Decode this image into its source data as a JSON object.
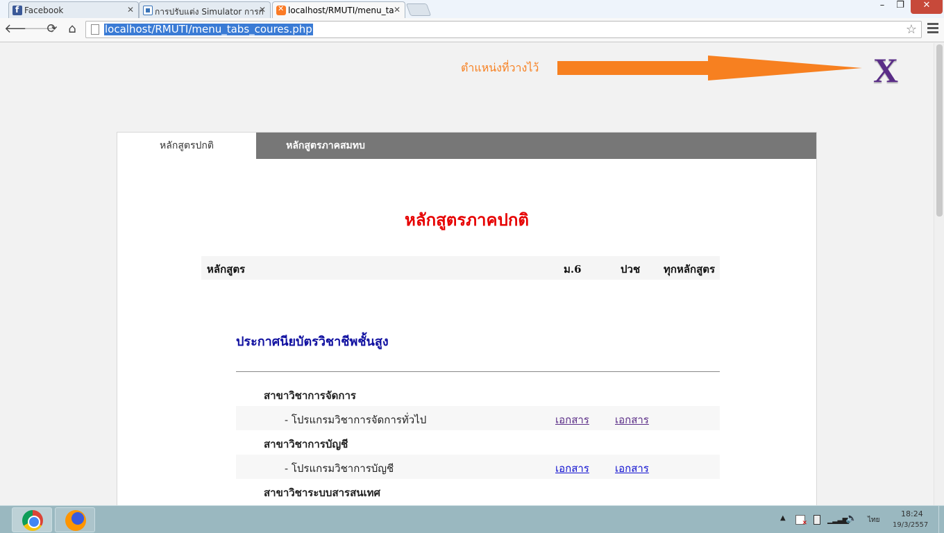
{
  "browser": {
    "tabs": [
      {
        "title": "Facebook",
        "icon": "facebook-icon"
      },
      {
        "title": "การปรับแต่ง Simulator การก่",
        "icon": "simulator-page-icon"
      },
      {
        "title": "localhost/RMUTI/menu_ta",
        "icon": "xampp-icon"
      }
    ],
    "window_controls": {
      "minimize": "–",
      "maximize": "❐",
      "close": "✕"
    },
    "url": "localhost/RMUTI/menu_tabs_coures.php"
  },
  "page": {
    "annotation": {
      "text": "ตำแหน่งที่วางไว้",
      "marker": "X",
      "arrow_color": "#f78020"
    },
    "course_tabs": [
      "หลักสูตรปกติ",
      "หลักสูตรภาคสมทบ"
    ],
    "section_title": "หลักสูตรภาคปกติ",
    "filter": {
      "label": "หลักสูตร",
      "options": [
        "ม.6",
        "ปวช",
        "ทุกหลักสูตร"
      ]
    },
    "certificate_heading": "ประกาศนียบัตรวิชาชีพชั้นสูง",
    "rows": [
      {
        "type": "department",
        "text": "สาขาวิชาการจัดการ"
      },
      {
        "type": "program",
        "text": "- โปรแกรมวิชาการจัดการทั่วไป",
        "doc1": "เอกสาร",
        "doc2": "เอกสาร"
      },
      {
        "type": "department",
        "text": "สาขาวิชาการบัญชี"
      },
      {
        "type": "program",
        "text": "- โปรแกรมวิชาการบัญชี",
        "doc1": "เอกสาร",
        "doc2": "เอกสาร"
      },
      {
        "type": "department",
        "text": "สาขาวิชาระบบสารสนเทศ"
      }
    ]
  },
  "taskbar": {
    "apps": [
      "chrome-icon",
      "firefox-icon"
    ],
    "language": "ไทย",
    "time": "18:24",
    "date": "19/3/2557"
  },
  "colors": {
    "accent_red": "#e60000",
    "heading_blue": "#1010a0",
    "link_purple": "#5a2d87",
    "link_blue": "#1010d0",
    "annotation_orange": "#f78020"
  }
}
